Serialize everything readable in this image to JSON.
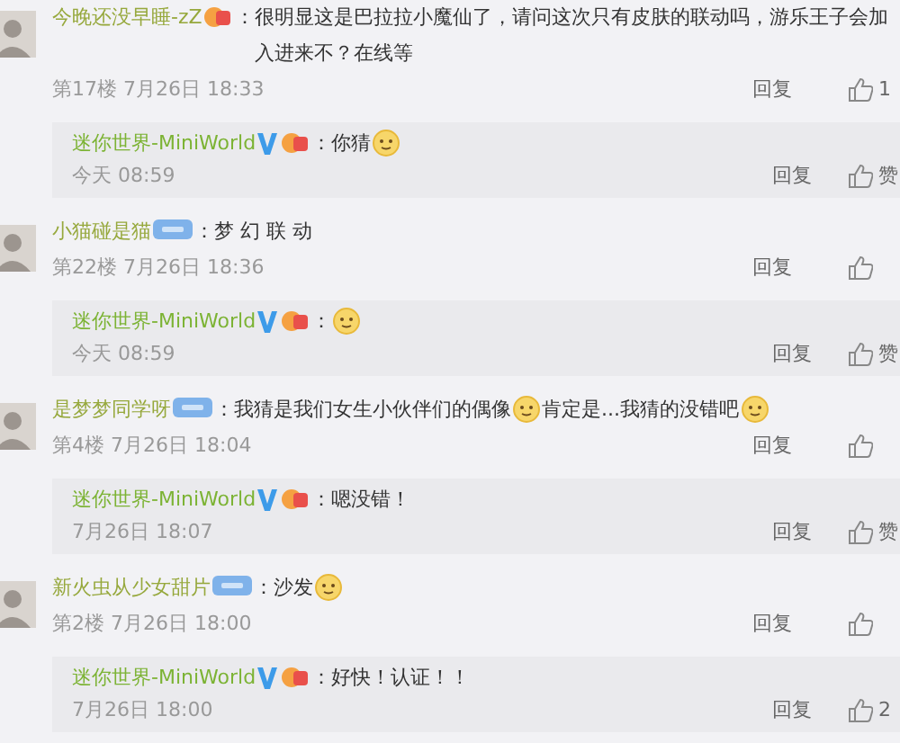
{
  "comments": [
    {
      "user": "今晚还没早睡-zZ",
      "badge": {
        "kind": "vip"
      },
      "separator": "：",
      "message": [
        {
          "kind": "text",
          "text": "很明显这是巴拉拉小魔仙了，请问这次只有皮肤的联动吗，游乐王子会加入进来不？在线等"
        }
      ],
      "meta": "第17楼 7月26日 18:33",
      "reply_label": "回复",
      "likes": "1",
      "reply": {
        "user": "迷你世界-MiniWorld",
        "verified": true,
        "badge": {
          "kind": "vip"
        },
        "separator": "：",
        "message": [
          {
            "kind": "text",
            "text": "你猜"
          },
          {
            "kind": "emoji"
          }
        ],
        "time": "今天 08:59",
        "reply_label": "回复",
        "likes": "赞"
      }
    },
    {
      "user": "小猫碰是猫",
      "badge": {
        "kind": "level"
      },
      "separator": "：",
      "message": [
        {
          "kind": "text",
          "text": "梦 幻 联 动"
        }
      ],
      "meta": "第22楼 7月26日 18:36",
      "reply_label": "回复",
      "reply": {
        "user": "迷你世界-MiniWorld",
        "verified": true,
        "badge": {
          "kind": "vip"
        },
        "separator": "：",
        "message": [
          {
            "kind": "emoji"
          }
        ],
        "time": "今天 08:59",
        "reply_label": "回复",
        "likes": "赞"
      }
    },
    {
      "user": "是梦梦同学呀",
      "badge": {
        "kind": "level"
      },
      "separator": "：",
      "message": [
        {
          "kind": "text",
          "text": "我猜是我们女生小伙伴们的偶像"
        },
        {
          "kind": "emoji"
        },
        {
          "kind": "text",
          "text": "肯定是...我猜的没错吧"
        },
        {
          "kind": "emoji"
        }
      ],
      "meta": "第4楼 7月26日 18:04",
      "reply_label": "回复",
      "reply": {
        "user": "迷你世界-MiniWorld",
        "verified": true,
        "badge": {
          "kind": "vip"
        },
        "separator": "：",
        "message": [
          {
            "kind": "text",
            "text": "嗯没错！"
          }
        ],
        "time": "7月26日 18:07",
        "reply_label": "回复",
        "likes": "赞"
      }
    },
    {
      "user": "新火虫从少女甜片",
      "badge": {
        "kind": "level"
      },
      "separator": "：",
      "message": [
        {
          "kind": "text",
          "text": "沙发"
        },
        {
          "kind": "emoji"
        }
      ],
      "meta": "第2楼 7月26日 18:00",
      "reply_label": "回复",
      "reply": {
        "user": "迷你世界-MiniWorld",
        "verified": true,
        "badge": {
          "kind": "vip"
        },
        "separator": "：",
        "message": [
          {
            "kind": "text",
            "text": "好快！认证！！"
          }
        ],
        "time": "7月26日 18:00",
        "reply_label": "回复",
        "likes": "2"
      }
    }
  ]
}
